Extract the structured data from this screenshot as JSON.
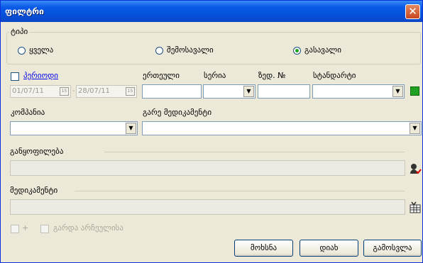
{
  "window": {
    "title": "ფილტრი",
    "close_glyph": "✕"
  },
  "type_group": {
    "label": "ტიპი",
    "options": [
      {
        "label": "ყველა",
        "selected": false
      },
      {
        "label": "შემოსავალი",
        "selected": false
      },
      {
        "label": "გასავალი",
        "selected": true
      }
    ]
  },
  "period": {
    "label": "პერიოდი",
    "checked": false,
    "from": "01/07/11",
    "to": "28/07/11",
    "cal_label": "15",
    "dash": "-"
  },
  "unit": {
    "label": "ერთეული",
    "value": ""
  },
  "series": {
    "label": "სერია",
    "value": ""
  },
  "number": {
    "label": "ზედ. №",
    "value": ""
  },
  "standard": {
    "label": "სტანდარტი",
    "value": "",
    "indicator_color": "#21a121"
  },
  "company": {
    "label": "კომპანია",
    "value": ""
  },
  "except_med": {
    "label": "გარე მედიკამენტი",
    "value": ""
  },
  "division": {
    "label": "განყოფილება",
    "value": ""
  },
  "medication": {
    "label": "მედიკამენტი",
    "value": ""
  },
  "bottom": {
    "plus_label": "+",
    "except_archive_label": "გარდა არჩეულისა"
  },
  "buttons": {
    "clear": "მოხსნა",
    "ok": "დიახ",
    "exit": "გამოსვლა"
  }
}
